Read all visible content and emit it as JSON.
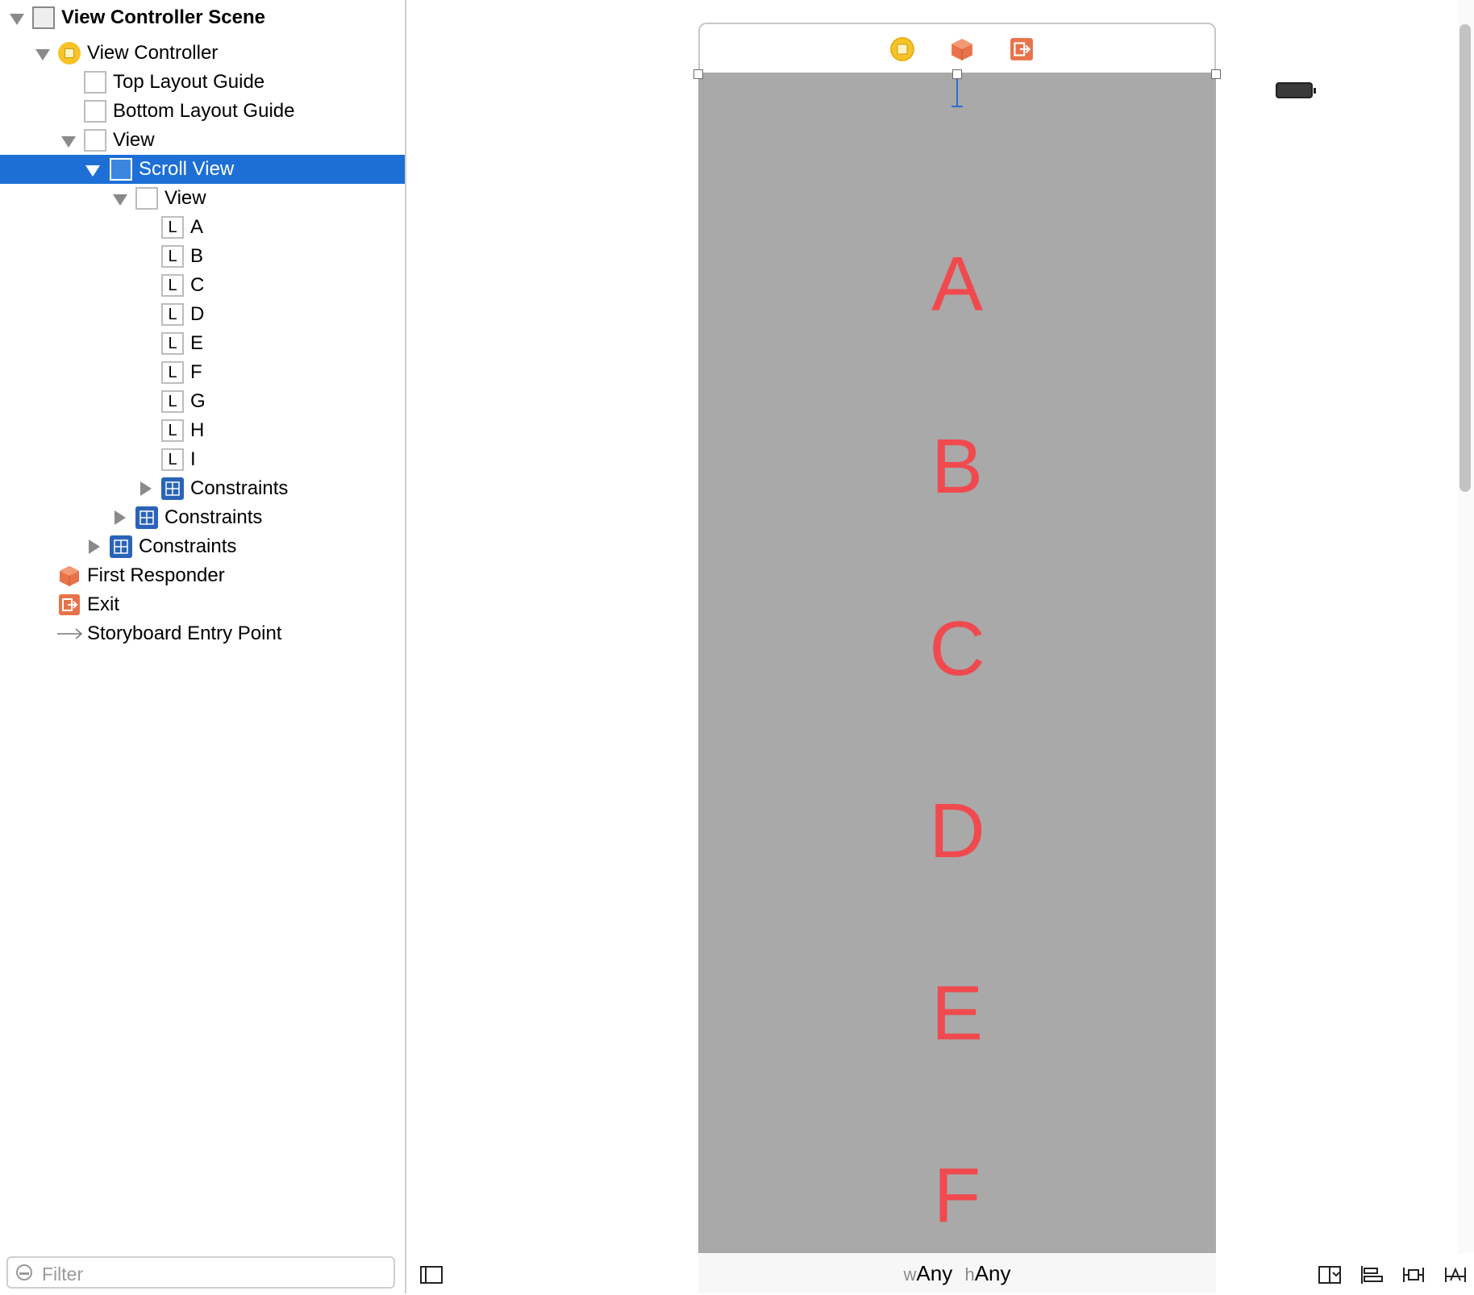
{
  "outline": {
    "scene_title": "View Controller Scene",
    "items": [
      {
        "label": "View Controller"
      },
      {
        "label": "Top Layout Guide"
      },
      {
        "label": "Bottom Layout Guide"
      },
      {
        "label": "View"
      },
      {
        "label": "Scroll View"
      },
      {
        "label": "View"
      },
      {
        "label": "A",
        "icon_glyph": "L"
      },
      {
        "label": "B",
        "icon_glyph": "L"
      },
      {
        "label": "C",
        "icon_glyph": "L"
      },
      {
        "label": "D",
        "icon_glyph": "L"
      },
      {
        "label": "E",
        "icon_glyph": "L"
      },
      {
        "label": "F",
        "icon_glyph": "L"
      },
      {
        "label": "G",
        "icon_glyph": "L"
      },
      {
        "label": "H",
        "icon_glyph": "L"
      },
      {
        "label": "I",
        "icon_glyph": "L"
      },
      {
        "label": "Constraints"
      },
      {
        "label": "Constraints"
      },
      {
        "label": "Constraints"
      },
      {
        "label": "First Responder"
      },
      {
        "label": "Exit"
      },
      {
        "label": "Storyboard Entry Point"
      }
    ],
    "selected_item": "Scroll View",
    "filter": {
      "placeholder": "Filter",
      "value": ""
    }
  },
  "canvas": {
    "letters": [
      "A",
      "B",
      "C",
      "D",
      "E",
      "F"
    ],
    "size_class": {
      "w_prefix": "w",
      "w_value": "Any",
      "h_prefix": "h",
      "h_value": "Any"
    }
  },
  "colors": {
    "selection": "#1d6fd6",
    "canvas_background": "#a9a9a9",
    "label_text": "#f04a4e",
    "view_controller_icon": "#f7c325",
    "first_responder_icon": "#e8734a",
    "exit_icon": "#e8734a",
    "constraints_icon": "#2a63b8"
  },
  "icons": {
    "scene": "storyboard-scene-icon",
    "view_controller": "view-controller-icon",
    "layout_guide": "layout-guide-icon",
    "view": "view-icon",
    "label": "label-icon",
    "constraints": "constraints-icon",
    "first_responder": "first-responder-cube-icon",
    "exit": "exit-icon",
    "entry_point": "arrow-right-icon"
  }
}
